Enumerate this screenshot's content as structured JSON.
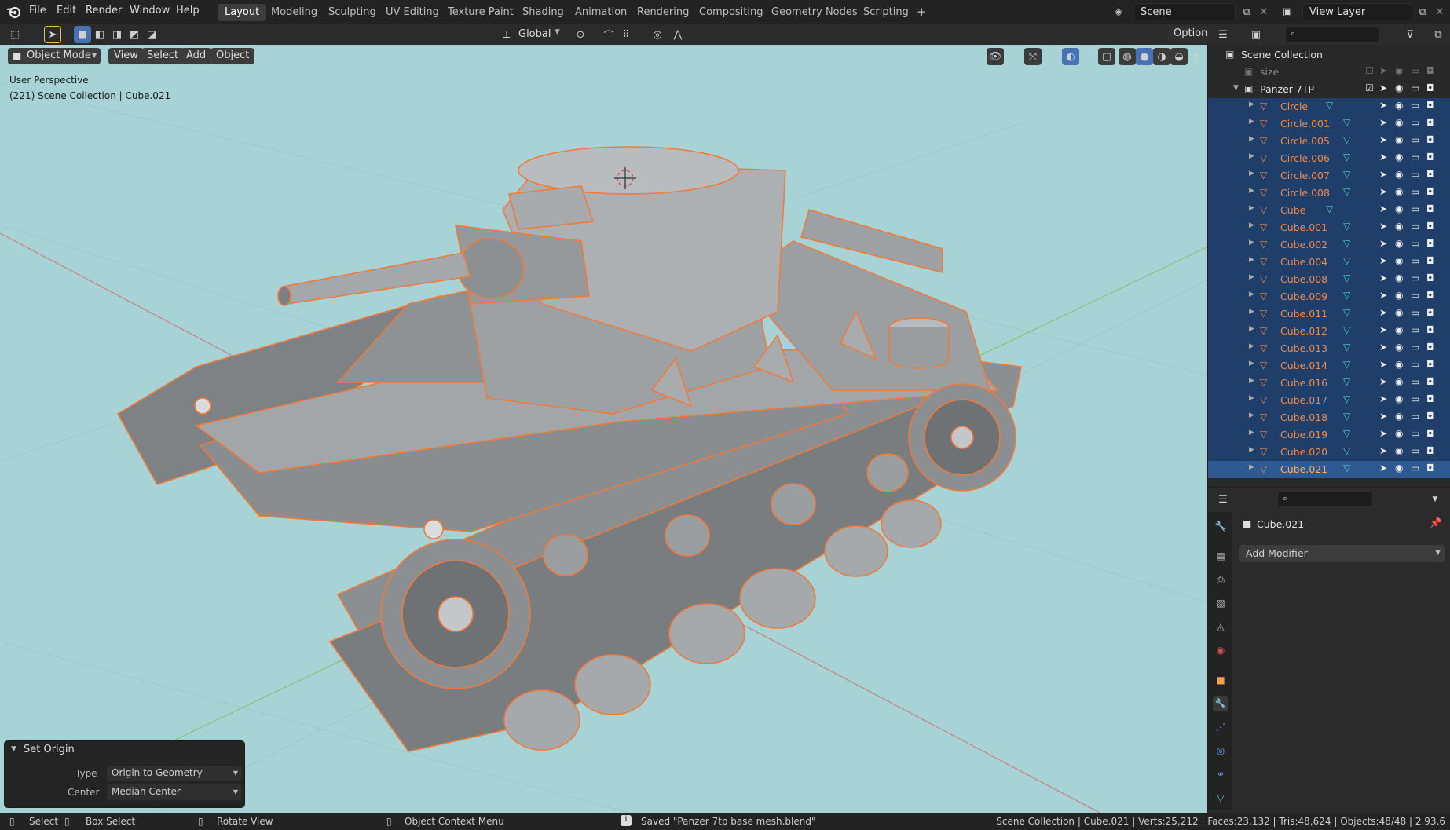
{
  "topbar": {
    "menus": [
      "File",
      "Edit",
      "Render",
      "Window",
      "Help"
    ],
    "workspaces": [
      "Layout",
      "Modeling",
      "Sculpting",
      "UV Editing",
      "Texture Paint",
      "Shading",
      "Animation",
      "Rendering",
      "Compositing",
      "Geometry Nodes",
      "Scripting"
    ],
    "active_workspace": "Layout",
    "add_tab": "+",
    "scene": "Scene",
    "view_layer": "View Layer"
  },
  "viewport_header": {
    "transform_orientation": "Global",
    "options": "Options",
    "mode": "Object Mode",
    "menus": [
      "View",
      "Select",
      "Add",
      "Object"
    ]
  },
  "viewport": {
    "perspective": "User Perspective",
    "context": "(221) Scene Collection | Cube.021"
  },
  "outliner": {
    "root": "Scene Collection",
    "items": [
      {
        "name": "size",
        "type": "collection",
        "state": "disabled"
      },
      {
        "name": "Panzer 7TP",
        "type": "collection",
        "state": "normal"
      },
      {
        "name": "Circle",
        "type": "mesh",
        "state": "selected"
      },
      {
        "name": "Circle.001",
        "type": "mesh",
        "state": "selected"
      },
      {
        "name": "Circle.005",
        "type": "mesh",
        "state": "selected"
      },
      {
        "name": "Circle.006",
        "type": "mesh",
        "state": "selected"
      },
      {
        "name": "Circle.007",
        "type": "mesh",
        "state": "selected"
      },
      {
        "name": "Circle.008",
        "type": "mesh",
        "state": "selected"
      },
      {
        "name": "Cube",
        "type": "mesh",
        "state": "selected"
      },
      {
        "name": "Cube.001",
        "type": "mesh",
        "state": "selected"
      },
      {
        "name": "Cube.002",
        "type": "mesh",
        "state": "selected"
      },
      {
        "name": "Cube.004",
        "type": "mesh",
        "state": "selected"
      },
      {
        "name": "Cube.008",
        "type": "mesh",
        "state": "selected"
      },
      {
        "name": "Cube.009",
        "type": "mesh",
        "state": "selected"
      },
      {
        "name": "Cube.011",
        "type": "mesh",
        "state": "selected"
      },
      {
        "name": "Cube.012",
        "type": "mesh",
        "state": "selected"
      },
      {
        "name": "Cube.013",
        "type": "mesh",
        "state": "selected"
      },
      {
        "name": "Cube.014",
        "type": "mesh",
        "state": "selected"
      },
      {
        "name": "Cube.016",
        "type": "mesh",
        "state": "selected"
      },
      {
        "name": "Cube.017",
        "type": "mesh",
        "state": "selected"
      },
      {
        "name": "Cube.018",
        "type": "mesh",
        "state": "selected"
      },
      {
        "name": "Cube.019",
        "type": "mesh",
        "state": "selected"
      },
      {
        "name": "Cube.020",
        "type": "mesh",
        "state": "selected"
      },
      {
        "name": "Cube.021",
        "type": "mesh",
        "state": "active"
      }
    ]
  },
  "properties": {
    "object_name": "Cube.021",
    "add_modifier": "Add Modifier"
  },
  "operator_panel": {
    "title": "Set Origin",
    "type_label": "Type",
    "type_value": "Origin to Geometry",
    "center_label": "Center",
    "center_value": "Median Center"
  },
  "statusbar": {
    "select": "Select",
    "box_select": "Box Select",
    "rotate_view": "Rotate View",
    "context_menu": "Object Context Menu",
    "message": "Saved \"Panzer 7tp base mesh.blend\"",
    "stats": "Scene Collection | Cube.021 | Verts:25,212 | Faces:23,132 | Tris:48,624 | Objects:48/48 | 2.93.6"
  },
  "colors": {
    "selected_outline": "#f08a4b",
    "viewport_bg": "#a8d3d6",
    "outliner_selected": "#1f3e6a",
    "outliner_active": "#2e5a91",
    "mesh_data_icon": "#4fd1c5"
  }
}
